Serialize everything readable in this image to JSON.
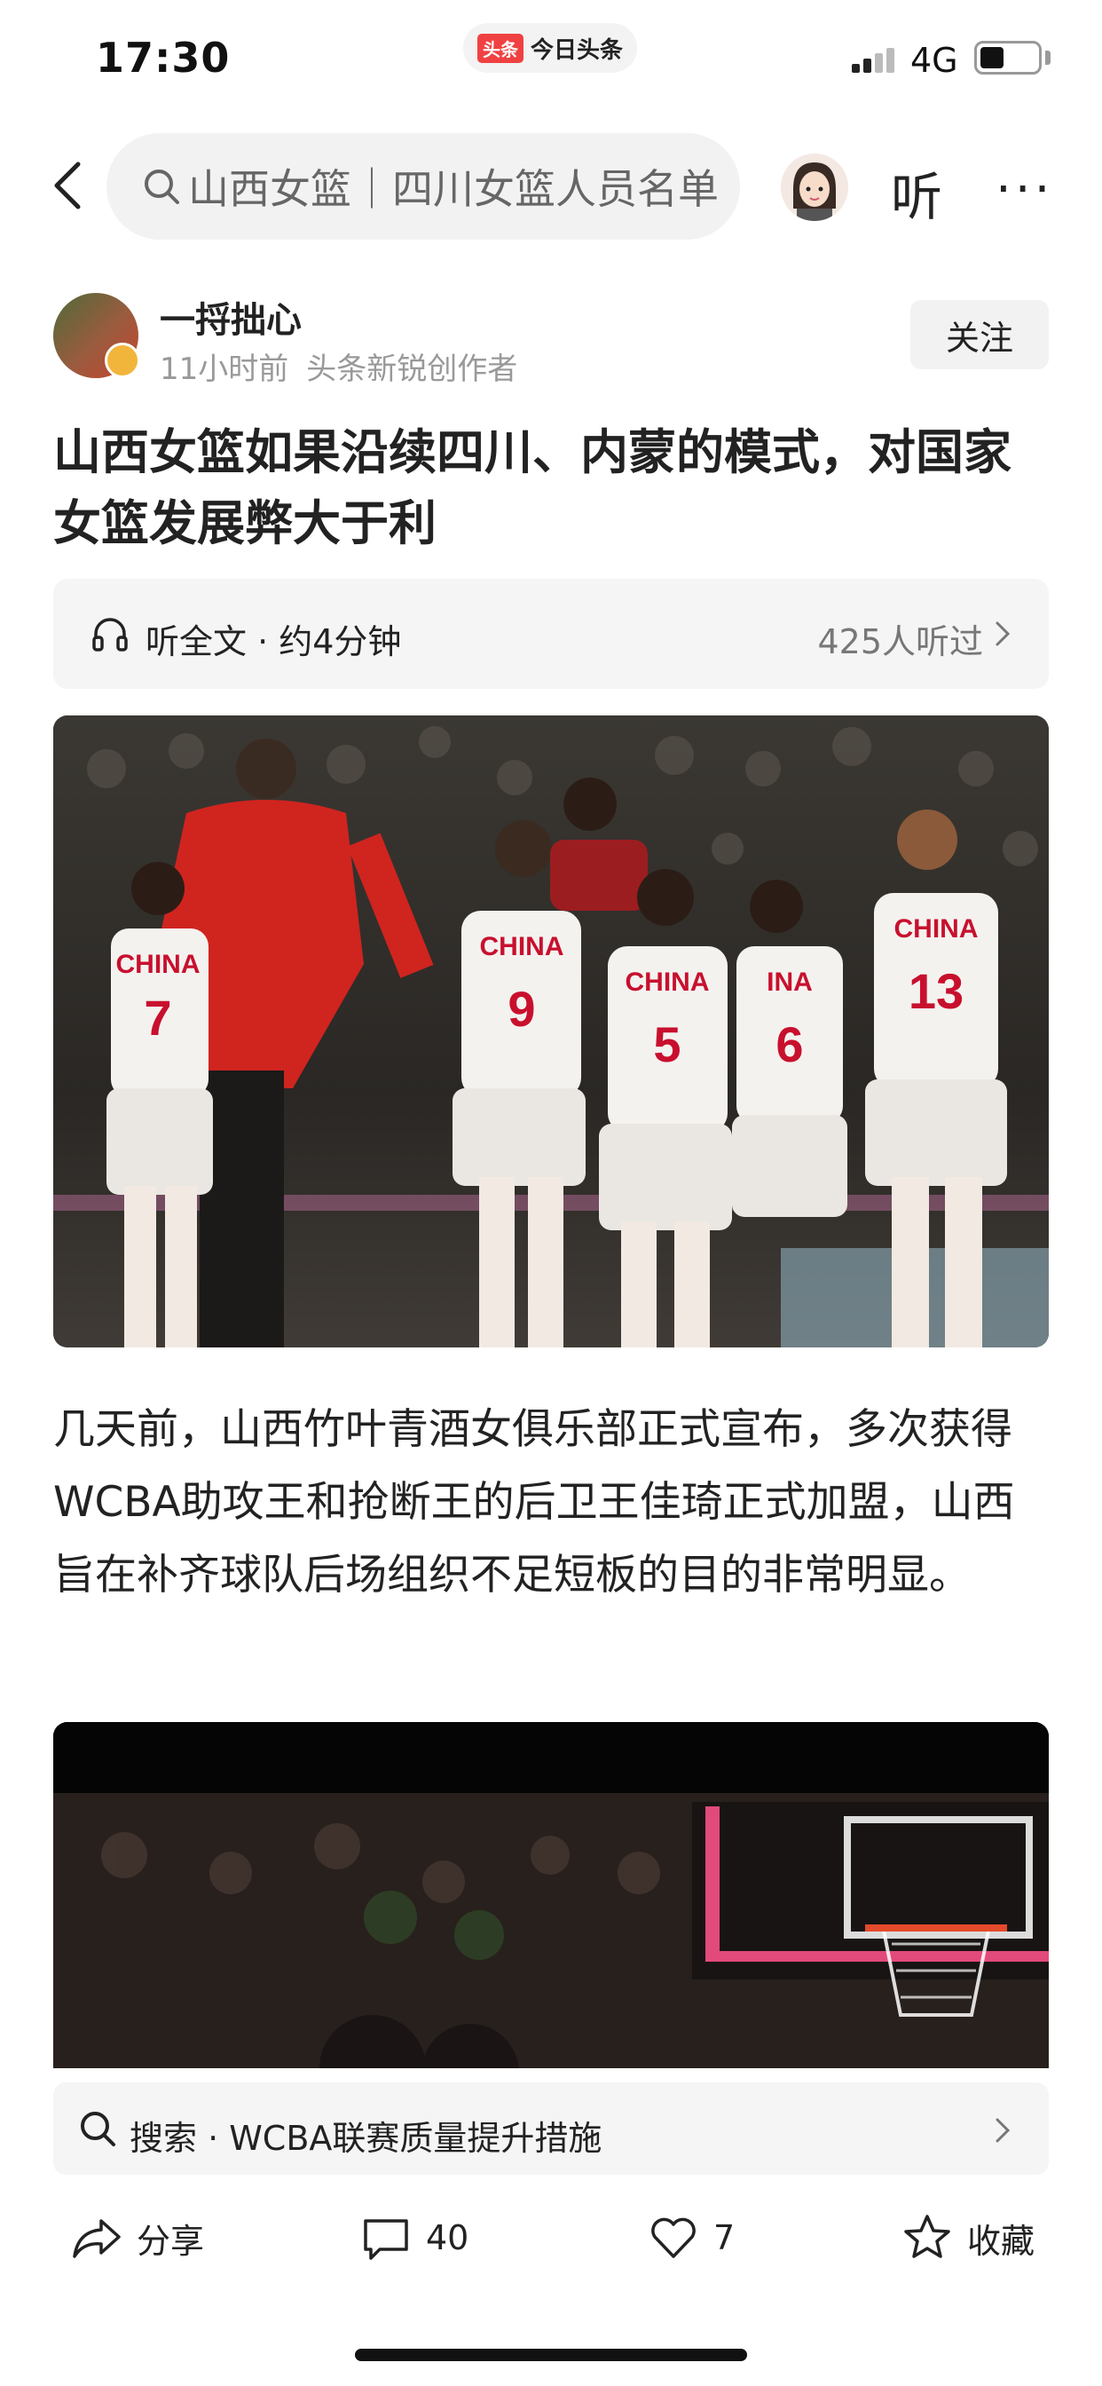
{
  "status_bar": {
    "time": "17:30",
    "app_badge": "头条",
    "app_name": "今日头条",
    "network": "4G"
  },
  "nav": {
    "search_text": "山西女篮｜四川女篮人员名单",
    "listen_label": "听",
    "more_label": "···"
  },
  "author": {
    "name": "一捋拙心",
    "time_ago": "11小时前",
    "role": "头条新锐创作者",
    "follow_label": "关注"
  },
  "article": {
    "title": "山西女篮如果沿续四川、内蒙的模式，对国家女篮发展弊大于利",
    "paragraph": "几天前，山西竹叶青酒女俱乐部正式宣布，多次获得WCBA助攻王和抢断王的后卫王佳琦正式加盟，山西旨在补齐球队后场组织不足短板的目的非常明显。"
  },
  "listen_bar": {
    "label": "听全文 · 约4分钟",
    "count": "425人听过"
  },
  "jerseys": [
    {
      "team": "CHINA",
      "number": "7"
    },
    {
      "team": "CHINA",
      "number": "9"
    },
    {
      "team": "CHINA",
      "number": "5"
    },
    {
      "team": "INA",
      "number": "6"
    },
    {
      "team": "CHINA",
      "number": "13"
    }
  ],
  "suggestion": {
    "text": "搜索 · WCBA联赛质量提升措施"
  },
  "actions": {
    "share_label": "分享",
    "comment_count": "40",
    "like_count": "7",
    "favorite_label": "收藏"
  },
  "colors": {
    "accent": "#f04142",
    "jersey_red": "#c8102e",
    "text_primary": "#222222",
    "text_secondary": "#999999"
  }
}
